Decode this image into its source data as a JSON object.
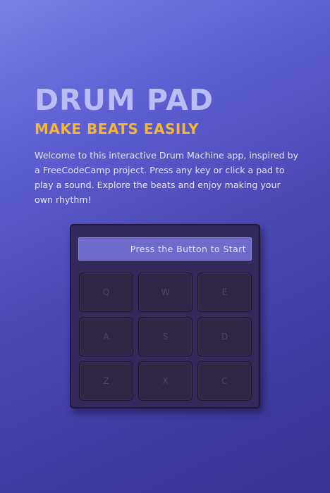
{
  "hero": {
    "title": "DRUM PAD",
    "subtitle": "MAKE BEATS EASILY",
    "intro": "Welcome to this interactive Drum Machine app, inspired by a FreeCodeCamp project. Press any key or click a pad to play a sound. Explore the beats and enjoy making your own rhythm!"
  },
  "machine": {
    "display_text": "Press the Button to Start",
    "pads": [
      {
        "key": "Q"
      },
      {
        "key": "W"
      },
      {
        "key": "E"
      },
      {
        "key": "A"
      },
      {
        "key": "S"
      },
      {
        "key": "D"
      },
      {
        "key": "Z"
      },
      {
        "key": "X"
      },
      {
        "key": "C"
      }
    ]
  },
  "colors": {
    "title": "#b9bdf4",
    "subtitle": "#f5b731",
    "display_bg": "#6f6bcb",
    "machine_bg": "#33295a",
    "pad_bg": "#2f2745"
  }
}
